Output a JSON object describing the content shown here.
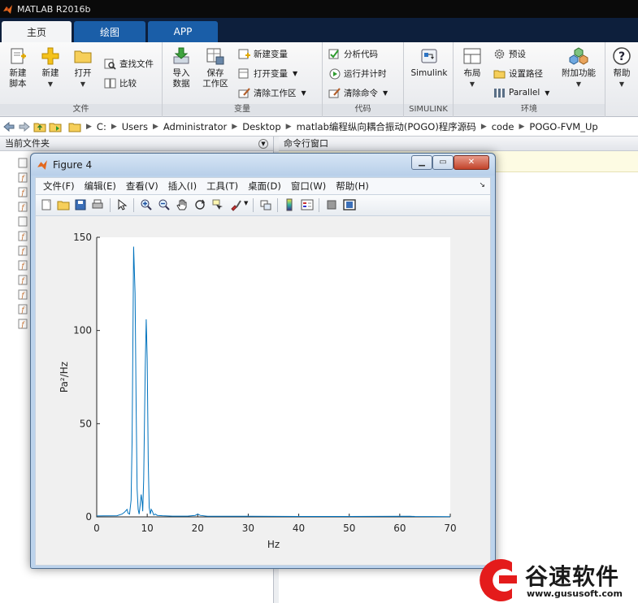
{
  "app": {
    "title": "MATLAB R2016b"
  },
  "tabs": [
    {
      "label": "主页"
    },
    {
      "label": "绘图"
    },
    {
      "label": "APP"
    }
  ],
  "ribbon": {
    "file": {
      "label": "文件",
      "new_script": "新建\n脚本",
      "new": "新建",
      "open": "打开",
      "find_files": "查找文件",
      "compare": "比较"
    },
    "variable": {
      "label": "变量",
      "import_data": "导入\n数据",
      "save_workspace": "保存\n工作区",
      "new_variable": "新建变量",
      "open_variable": "打开变量",
      "clear_workspace": "清除工作区"
    },
    "code": {
      "label": "代码",
      "analyze_code": "分析代码",
      "run_and_time": "运行并计时",
      "clear_commands": "清除命令"
    },
    "simulink": {
      "label": "SIMULINK",
      "simulink": "Simulink"
    },
    "environment": {
      "label": "环境",
      "layout": "布局",
      "preferences": "预设",
      "set_path": "设置路径",
      "parallel": "Parallel",
      "addons": "附加功能"
    },
    "help": "帮助"
  },
  "address": {
    "crumbs": [
      "C:",
      "Users",
      "Administrator",
      "Desktop",
      "matlab编程纵向耦合振动(POGO)程序源码",
      "code",
      "POGO-FVM_Up"
    ]
  },
  "panels": {
    "current_folder": "当前文件夹",
    "command_window": "命令行窗口"
  },
  "figure": {
    "title": "Figure 4",
    "menus": [
      "文件(F)",
      "编辑(E)",
      "查看(V)",
      "插入(I)",
      "工具(T)",
      "桌面(D)",
      "窗口(W)",
      "帮助(H)"
    ],
    "toolbar_icons": [
      "new-figure-icon",
      "open-file-icon",
      "save-icon",
      "print-icon",
      "edit-plot-arrow-icon",
      "zoom-in-icon",
      "zoom-out-icon",
      "pan-hand-icon",
      "rotate-3d-icon",
      "data-cursor-icon",
      "brush-icon",
      "link-plot-icon",
      "colorbar-icon",
      "legend-icon",
      "hide-plot-tools-icon",
      "show-plot-tools-icon"
    ]
  },
  "chart_data": {
    "type": "line",
    "xlabel": "Hz",
    "ylabel": "Pa²/Hz",
    "xlim": [
      0,
      70
    ],
    "ylim": [
      0,
      150
    ],
    "xticks": [
      0,
      10,
      20,
      30,
      40,
      50,
      60,
      70
    ],
    "yticks": [
      0,
      50,
      100,
      150
    ],
    "grid": false,
    "series": [
      {
        "color": "#0072bd",
        "x": [
          0,
          4,
          5,
          5.5,
          6,
          6.2,
          6.5,
          6.8,
          7,
          7.1,
          7.3,
          7.6,
          7.8,
          8.0,
          8.2,
          8.4,
          8.6,
          8.8,
          9.0,
          9.1,
          9.3,
          9.6,
          9.8,
          10.0,
          10.2,
          10.4,
          10.6,
          10.8,
          11.0,
          11.3,
          11.6,
          12,
          13,
          15,
          18,
          19.5,
          20,
          20.5,
          22,
          30,
          40,
          50,
          62,
          63,
          70
        ],
        "y": [
          0.5,
          0.6,
          1.5,
          2.5,
          4,
          2,
          1.5,
          9,
          40,
          70,
          145,
          120,
          60,
          15,
          4,
          1.5,
          6,
          12,
          8,
          3,
          20,
          80,
          106,
          85,
          30,
          5,
          1.5,
          4,
          3,
          1,
          1.5,
          0.8,
          0.6,
          0.4,
          0.4,
          0.8,
          1.5,
          0.8,
          0.3,
          0.3,
          0.2,
          0.2,
          0.3,
          0.2,
          0.1
        ]
      }
    ]
  },
  "watermark": {
    "name": "谷速软件",
    "url": "www.gususoft.com"
  }
}
